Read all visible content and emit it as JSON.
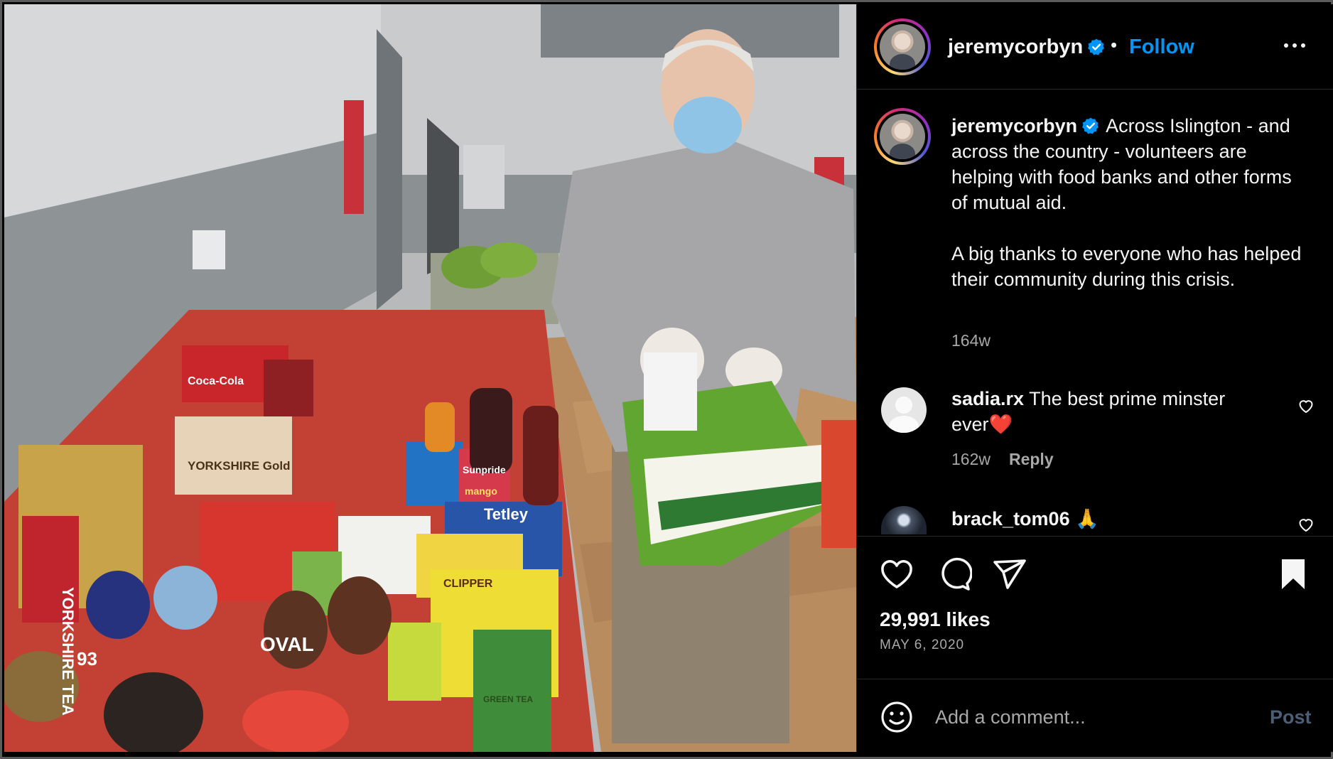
{
  "post": {
    "username": "jeremycorbyn",
    "follow_label": "Follow",
    "separator": "•",
    "verified_icon": "verified-badge-icon",
    "caption_username": "jeremycorbyn",
    "caption_text": "Across Islington - and across the country - volunteers are helping with food banks and other forms of mutual aid.\n\nA big thanks to everyone who has helped their community during this crisis.",
    "caption_time": "164w",
    "likes": "29,991 likes",
    "date": "MAY 6, 2020"
  },
  "comments": [
    {
      "username": "sadia.rx",
      "text": "The best prime minster ever❤️",
      "time": "162w",
      "reply_label": "Reply"
    },
    {
      "username": "brack_tom06",
      "text": "🙏"
    }
  ],
  "add_comment": {
    "placeholder": "Add a comment...",
    "post_label": "Post"
  },
  "photo": {
    "packaging_text": [
      "Coca-Cola",
      "YORKSHIRE Gold",
      "YORKSHIRE TEA",
      "Tetley",
      "Sunpride",
      "mango",
      "OVAL",
      "93",
      "GREEN TEA",
      "CLIPPER"
    ]
  },
  "colors": {
    "accent": "#0095f6",
    "background": "#000000",
    "muted_text": "#a8a8a8",
    "post_disabled": "#4c5e75"
  }
}
